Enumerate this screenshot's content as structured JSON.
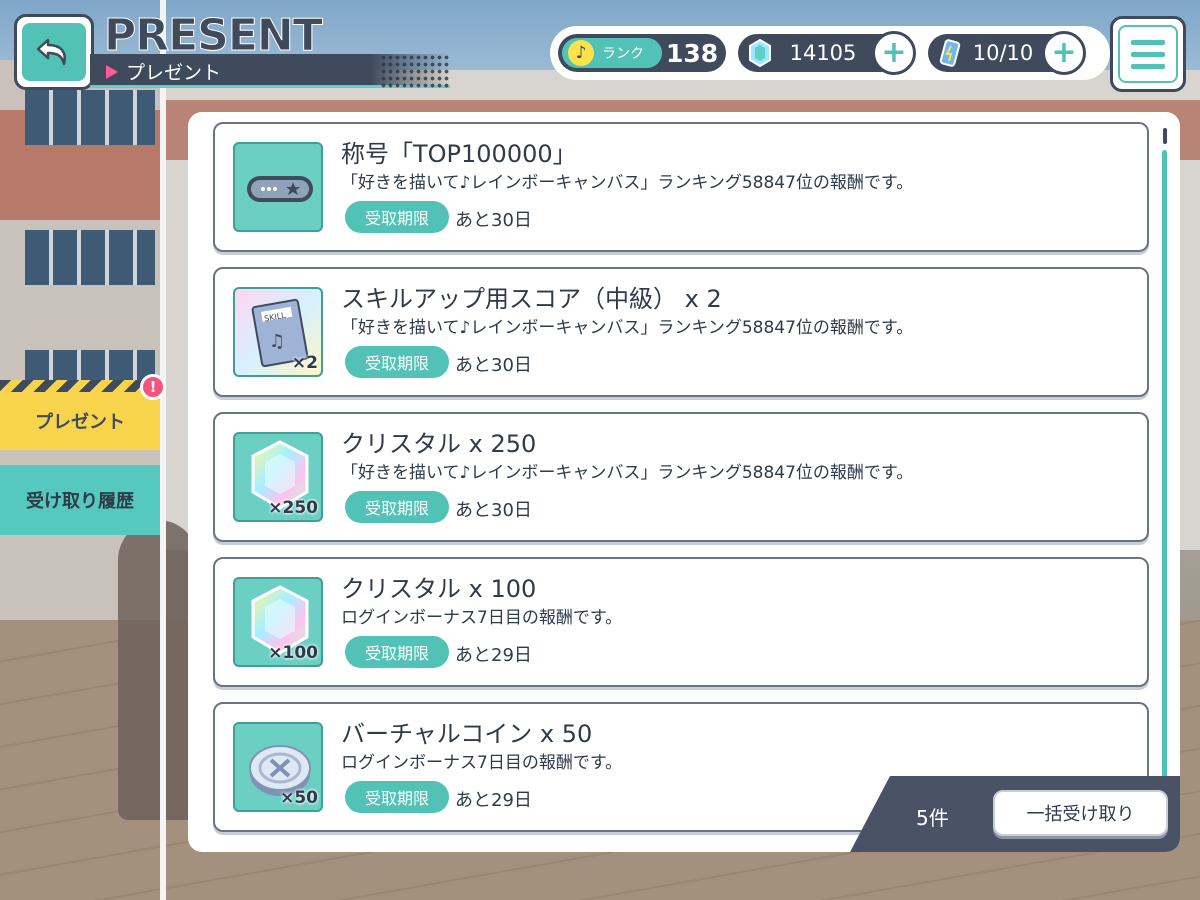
{
  "header": {
    "title_en": "PRESENT",
    "title_jp": "プレゼント"
  },
  "status": {
    "rank_label": "ランク",
    "rank_value": "138",
    "crystals": "14105",
    "energy": "10/10"
  },
  "sidebar": {
    "tabs": [
      {
        "label": "プレゼント",
        "active": true,
        "badge": "!"
      },
      {
        "label": "受け取り履歴",
        "active": false
      }
    ]
  },
  "presents": [
    {
      "name": "称号「TOP100000」",
      "desc": "「好きを描いて♪レインボーキャンバス」ランキング58847位の報酬です。",
      "limit_label": "受取期限",
      "limit": "あと30日",
      "icon": "title-plate-icon",
      "qty": ""
    },
    {
      "name": "スキルアップ用スコア（中級） x 2",
      "desc": "「好きを描いて♪レインボーキャンバス」ランキング58847位の報酬です。",
      "limit_label": "受取期限",
      "limit": "あと30日",
      "icon": "skill-score-icon",
      "qty": "×2"
    },
    {
      "name": "クリスタル x 250",
      "desc": "「好きを描いて♪レインボーキャンバス」ランキング58847位の報酬です。",
      "limit_label": "受取期限",
      "limit": "あと30日",
      "icon": "crystal-icon",
      "qty": "×250"
    },
    {
      "name": "クリスタル x 100",
      "desc": "ログインボーナス7日目の報酬です。",
      "limit_label": "受取期限",
      "limit": "あと29日",
      "icon": "crystal-icon",
      "qty": "×100"
    },
    {
      "name": "バーチャルコイン x 50",
      "desc": "ログインボーナス7日目の報酬です。",
      "limit_label": "受取期限",
      "limit": "あと29日",
      "icon": "virtual-coin-icon",
      "qty": "×50"
    }
  ],
  "footer": {
    "count": "5件",
    "bulk_receive_label": "一括受け取り"
  },
  "colors": {
    "accent": "#52c2b7",
    "dark": "#3f4a5c",
    "tab_active": "#f7d44c",
    "badge": "#f2547c"
  }
}
